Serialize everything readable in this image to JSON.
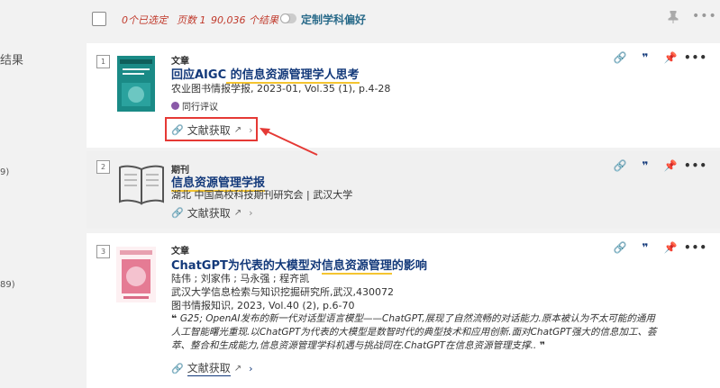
{
  "left": {
    "label1": "结果",
    "label2": "9)",
    "label3": "89)"
  },
  "topbar": {
    "selected": "0个已选定",
    "pages": "页数 1",
    "results": "90,036 个结果",
    "customize": "定制学科偏好"
  },
  "items": [
    {
      "num": "1",
      "type": "文章",
      "title_a": "回应AIGC",
      "title_b": " 的信息资源管理学人思考",
      "source": "农业图书情报学报, 2023-01, Vol.35 (1), p.4-28",
      "peer": "同行评议",
      "access": "文献获取"
    },
    {
      "num": "2",
      "type": "期刊",
      "title": "信息资源管理学报",
      "publisher": "湖北 中国高校科技期刊研究会 | 武汉大学",
      "access": "文献获取"
    },
    {
      "num": "3",
      "type": "文章",
      "title_a": "ChatGPT为代表的大模型对",
      "title_b": "信息资源管理",
      "title_c": "的影响",
      "authors": "陆伟 ; 刘家伟 ; 马永强 ; 程齐凯",
      "affil": "武汉大学信息检索与知识挖掘研究所,武汉,430072",
      "source": "图书情报知识, 2023, Vol.40 (2), p.6-70",
      "abs1": "G25; OpenAI发布的新一代对话型语言模型——ChatGPT,展现了自然流畅的对话能力.原本被认为不太可能的通用",
      "abs2": "人工智能曙光重现.以ChatGPT为代表的大模型是数智时代的典型技术和应用创新.面对ChatGPT强大的信息加工、荟",
      "abs3": "萃、整合和生成能力,信息资源管理学科机遇与挑战同在.ChatGPT在信息资源管理支撑..",
      "access": "文献获取"
    }
  ]
}
